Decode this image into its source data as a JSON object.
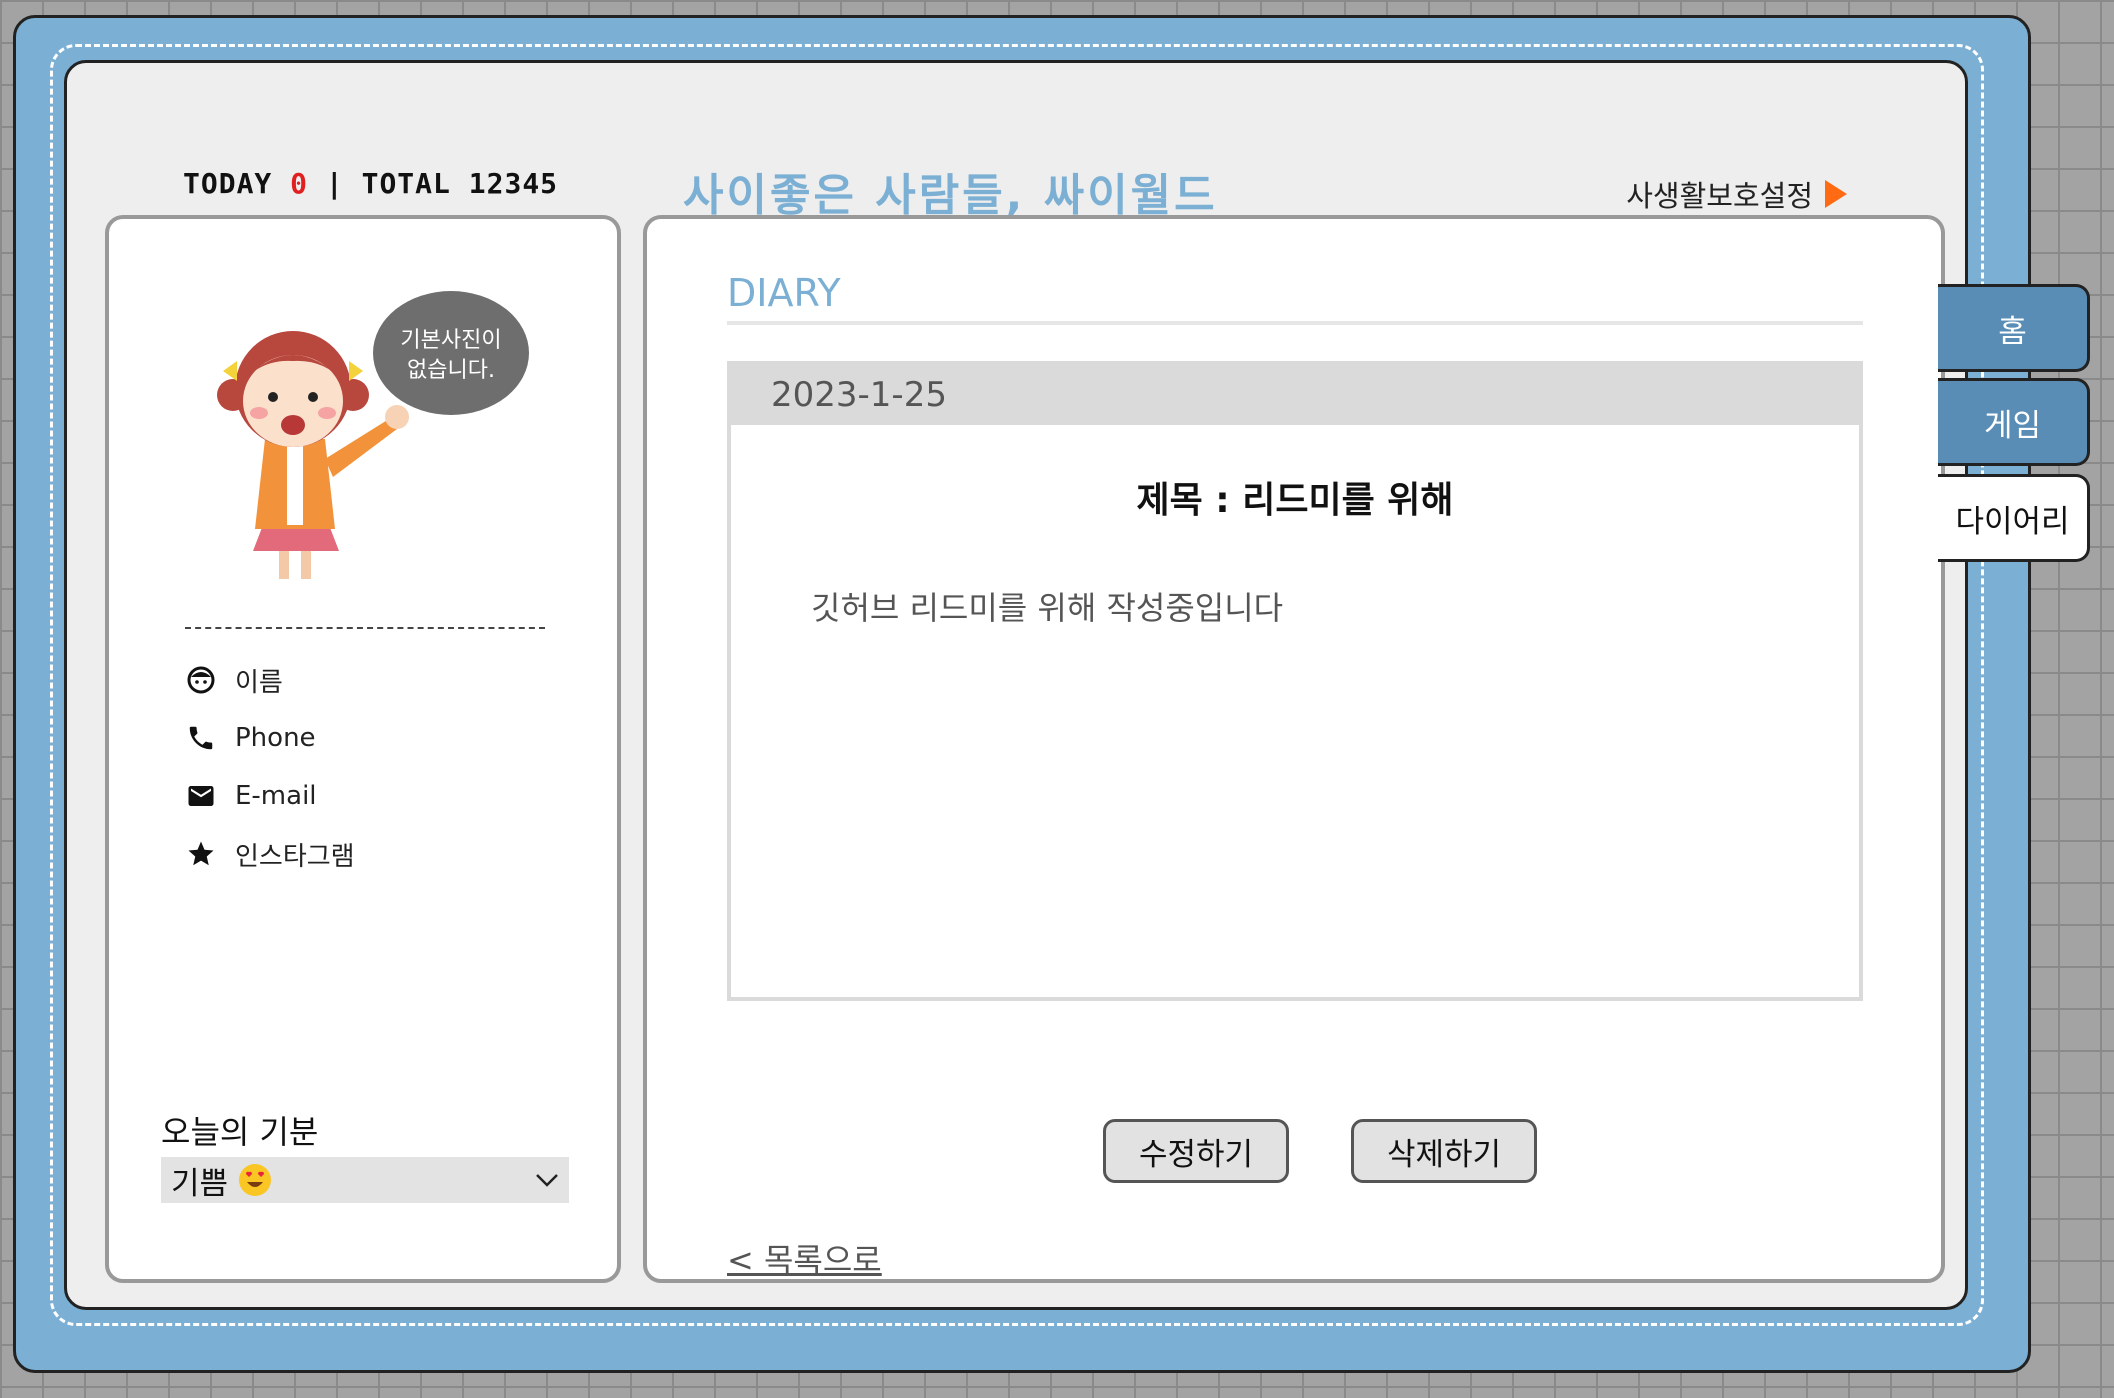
{
  "header": {
    "today_label": "TODAY",
    "today_count": "0",
    "separator": "|",
    "total_label": "TOTAL",
    "total_count": "12345",
    "site_title": "사이좋은 사람들, 싸이월드",
    "privacy_link": "사생활보호설정"
  },
  "profile": {
    "speech_bubble_line1": "기본사진이",
    "speech_bubble_line2": "없습니다.",
    "info": [
      {
        "icon": "face-icon",
        "label": "이름"
      },
      {
        "icon": "phone-icon",
        "label": "Phone"
      },
      {
        "icon": "mail-icon",
        "label": "E-mail"
      },
      {
        "icon": "star-icon",
        "label": "인스타그램"
      }
    ],
    "mood_label": "오늘의 기분",
    "mood_value": "기쁨",
    "mood_emoji": "heart-eyes-emoji-icon"
  },
  "diary": {
    "section_title": "DIARY",
    "entry_date": "2023-1-25",
    "entry_subject": "제목 : 리드미를 위해",
    "entry_body": "깃허브 리드미를 위해 작성중입니다",
    "edit_button": "수정하기",
    "delete_button": "삭제하기",
    "back_link": "< 목록으로"
  },
  "tabs": [
    {
      "label": "홈",
      "active": false
    },
    {
      "label": "게임",
      "active": false
    },
    {
      "label": "다이어리",
      "active": true
    }
  ],
  "colors": {
    "frame_blue": "#7bafd3",
    "tab_blue": "#5a8db6",
    "accent_orange": "#ff6a13",
    "today_red": "#e02020"
  }
}
